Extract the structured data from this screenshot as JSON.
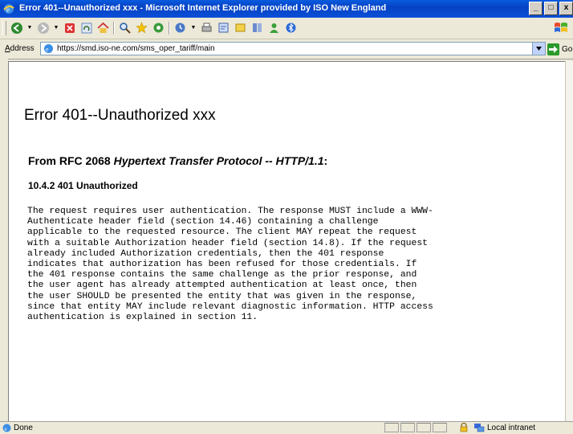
{
  "window": {
    "title": "Error 401--Unauthorized xxx - Microsoft Internet Explorer provided by ISO New England",
    "minimize_glyph": "_",
    "restore_glyph": "□",
    "close_glyph": "x"
  },
  "address_bar": {
    "label_first": "A",
    "label_rest": "ddress",
    "url": "https://smd.iso-ne.com/sms_oper_tariff/main",
    "go_label": "Go"
  },
  "page": {
    "heading": "Error 401--Unauthorized xxx",
    "rfc_prefix": "From RFC 2068 ",
    "rfc_title": "Hypertext Transfer Protocol -- HTTP/1.1",
    "rfc_suffix": ":",
    "section": "10.4.2 401 Unauthorized",
    "body_lines": [
      "The request requires user authentication. The response MUST include a WWW-",
      "Authenticate header field (section 14.46) containing a challenge",
      "applicable to the requested resource. The client MAY repeat the request",
      "with a suitable Authorization header field (section 14.8). If the request",
      "already included Authorization credentials, then the 401 response",
      "indicates that authorization has been refused for those credentials. If",
      "the 401 response contains the same challenge as the prior response, and",
      "the user agent has already attempted authentication at least once, then",
      "the user SHOULD be presented the entity that was given in the response,",
      "since that entity MAY include relevant diagnostic information. HTTP access",
      "authentication is explained in section 11."
    ]
  },
  "status_bar": {
    "status": "Done",
    "zone": "Local intranet"
  },
  "toolbar_icons": [
    "back-icon",
    "forward-icon",
    "stop-icon",
    "refresh-icon",
    "home-icon",
    "search-icon",
    "favorites-icon",
    "media-icon",
    "history-icon",
    "mail-icon",
    "print-icon",
    "edit-icon",
    "discuss-icon",
    "research-icon",
    "messenger-icon",
    "bluetooth-icon"
  ],
  "colors": {
    "titlebar": "#0a4fd8",
    "chrome": "#ece9d8",
    "page_bg": "#ffffff"
  }
}
